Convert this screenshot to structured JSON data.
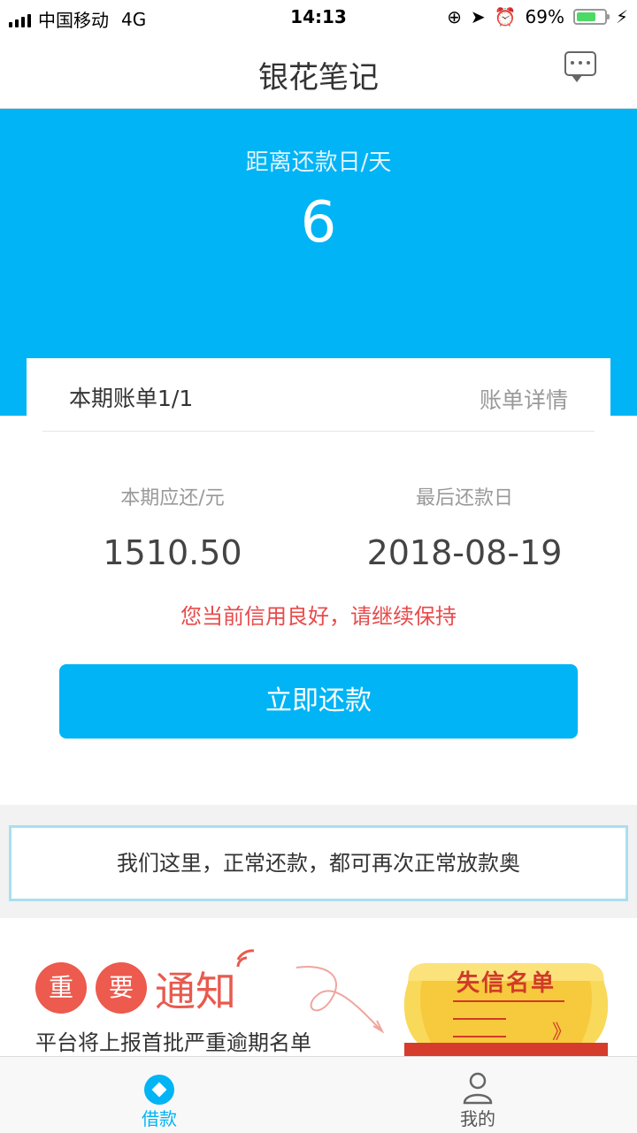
{
  "status_bar": {
    "carrier": "中国移动",
    "network": "4G",
    "time": "14:13",
    "battery": "69%",
    "battery_level": 0.69
  },
  "navbar": {
    "title": "银花笔记",
    "message_icon": "message-icon"
  },
  "hero": {
    "label": "距离还款日/天",
    "days": "6"
  },
  "bill": {
    "period_label": "本期账单1/1",
    "detail_link": "账单详情",
    "due_amount_label": "本期应还/元",
    "due_amount": "1510.50",
    "last_date_label": "最后还款日",
    "last_date": "2018-08-19",
    "credit_message": "您当前信用良好，请继续保持",
    "pay_button": "立即还款"
  },
  "notice_box": {
    "text": "我们这里，正常还款，都可再次正常放款奥"
  },
  "banner": {
    "char1": "重",
    "char2": "要",
    "word": "通知",
    "subtitle": "平台将上报首批严重逾期名单",
    "scroll_title": "失信名单",
    "scroll_arrow": "》"
  },
  "tabbar": {
    "tabs": [
      {
        "label": "借款",
        "icon": "loan-icon",
        "active": true
      },
      {
        "label": "我的",
        "icon": "user-icon",
        "active": false
      }
    ]
  },
  "colors": {
    "accent": "#00b4f5",
    "warning": "#e84a4a",
    "banner_red": "#ed5a4e"
  }
}
